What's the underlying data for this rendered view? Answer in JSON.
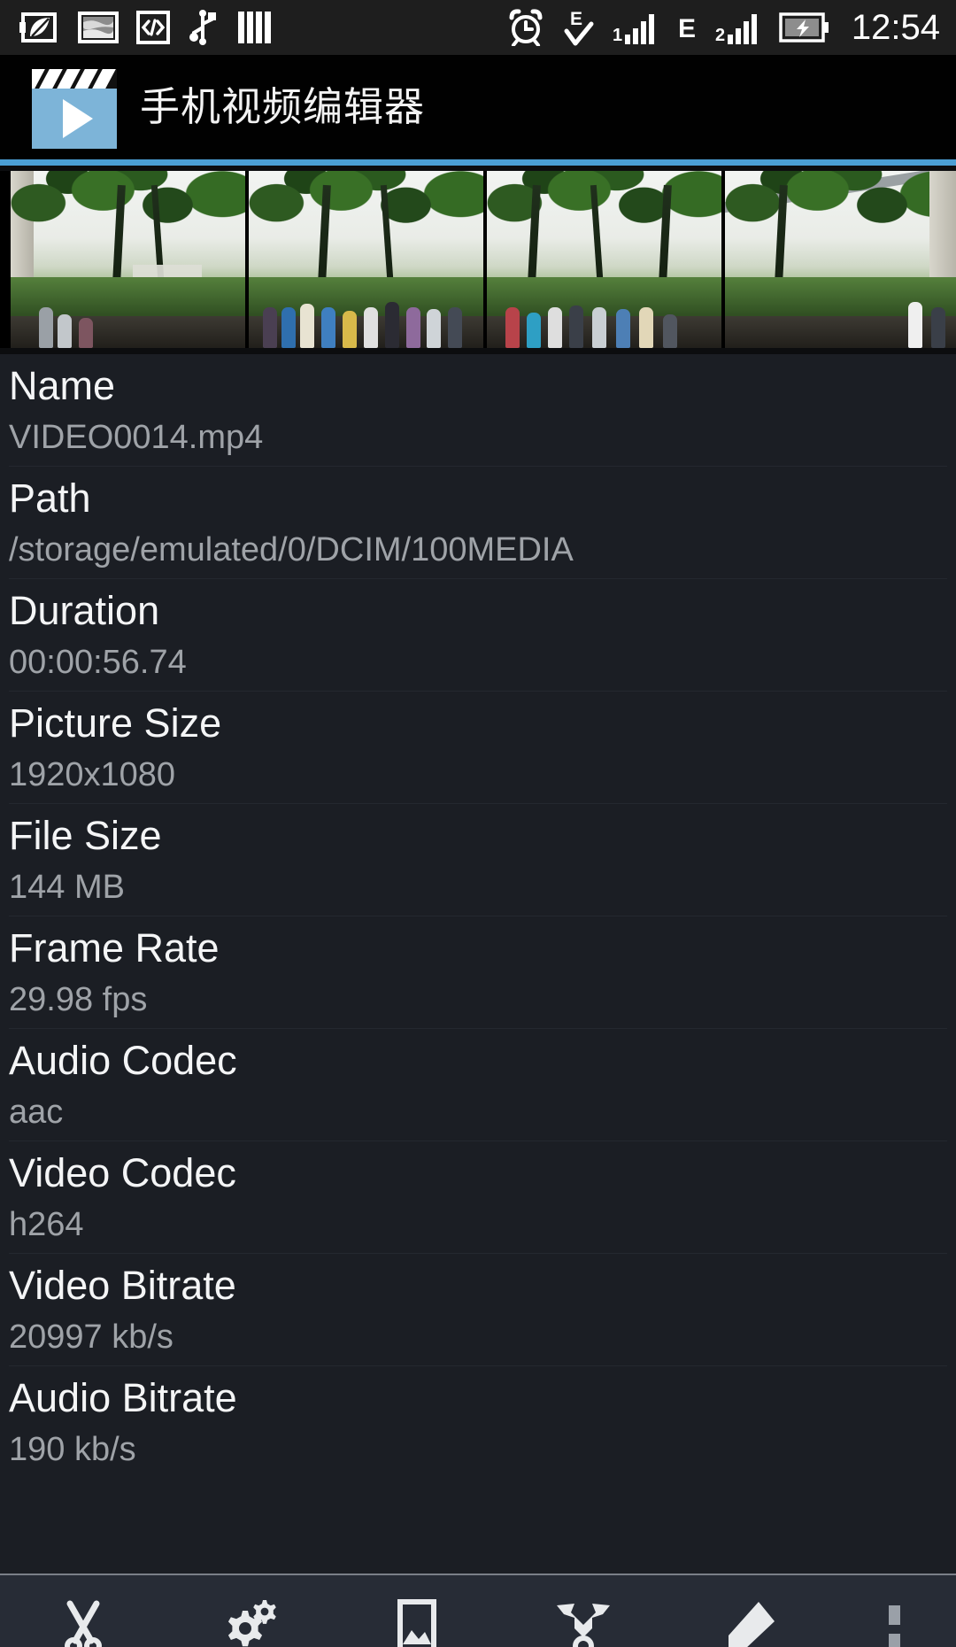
{
  "status_bar": {
    "time": "12:54",
    "icons": [
      {
        "name": "power-saver-leaf-icon"
      },
      {
        "name": "screenshot-icon"
      },
      {
        "name": "developer-code-icon"
      },
      {
        "name": "usb-icon"
      },
      {
        "name": "vpn-bars-icon"
      },
      {
        "name": "alarm-clock-icon"
      },
      {
        "name": "edge-data-check-icon"
      },
      {
        "name": "signal-bars-sim1-icon"
      },
      {
        "name": "edge-network-icon"
      },
      {
        "name": "signal-bars-sim2-icon"
      },
      {
        "name": "battery-charging-icon"
      }
    ],
    "network_label_1": "E",
    "network_label_2": "E",
    "sim1_label": "1",
    "sim2_label": "2"
  },
  "title_bar": {
    "app_name": "手机视频编辑器",
    "logo_icon": "clapperboard-play-icon",
    "accent_color": "#4b9fd5"
  },
  "thumbnails": {
    "name": "video-frame-thumbnails",
    "count": 4,
    "items": [
      {
        "alt": "park pavilion with trees"
      },
      {
        "alt": "crowd walking under trees"
      },
      {
        "alt": "crowd beneath willow trees"
      },
      {
        "alt": "garden path beside white wall"
      }
    ]
  },
  "metadata": {
    "rows": [
      {
        "label": "Name",
        "value": "VIDEO0014.mp4"
      },
      {
        "label": "Path",
        "value": "/storage/emulated/0/DCIM/100MEDIA"
      },
      {
        "label": "Duration",
        "value": "00:00:56.74"
      },
      {
        "label": "Picture Size",
        "value": "1920x1080"
      },
      {
        "label": "File Size",
        "value": "144 MB"
      },
      {
        "label": "Frame Rate",
        "value": "29.98 fps"
      },
      {
        "label": "Audio Codec",
        "value": "aac"
      },
      {
        "label": "Video Codec",
        "value": "h264"
      },
      {
        "label": "Video Bitrate",
        "value": "20997 kb/s"
      },
      {
        "label": "Audio Bitrate",
        "value": "190 kb/s"
      }
    ]
  },
  "toolbar": {
    "items": [
      {
        "name": "trim-scissors-icon",
        "label": "Trim"
      },
      {
        "name": "settings-gears-icon",
        "label": "Settings"
      },
      {
        "name": "image-frame-icon",
        "label": "Image"
      },
      {
        "name": "merge-arrows-icon",
        "label": "Merge"
      },
      {
        "name": "eraser-icon",
        "label": "Erase"
      },
      {
        "name": "overflow-menu-icon",
        "label": "More"
      }
    ]
  }
}
